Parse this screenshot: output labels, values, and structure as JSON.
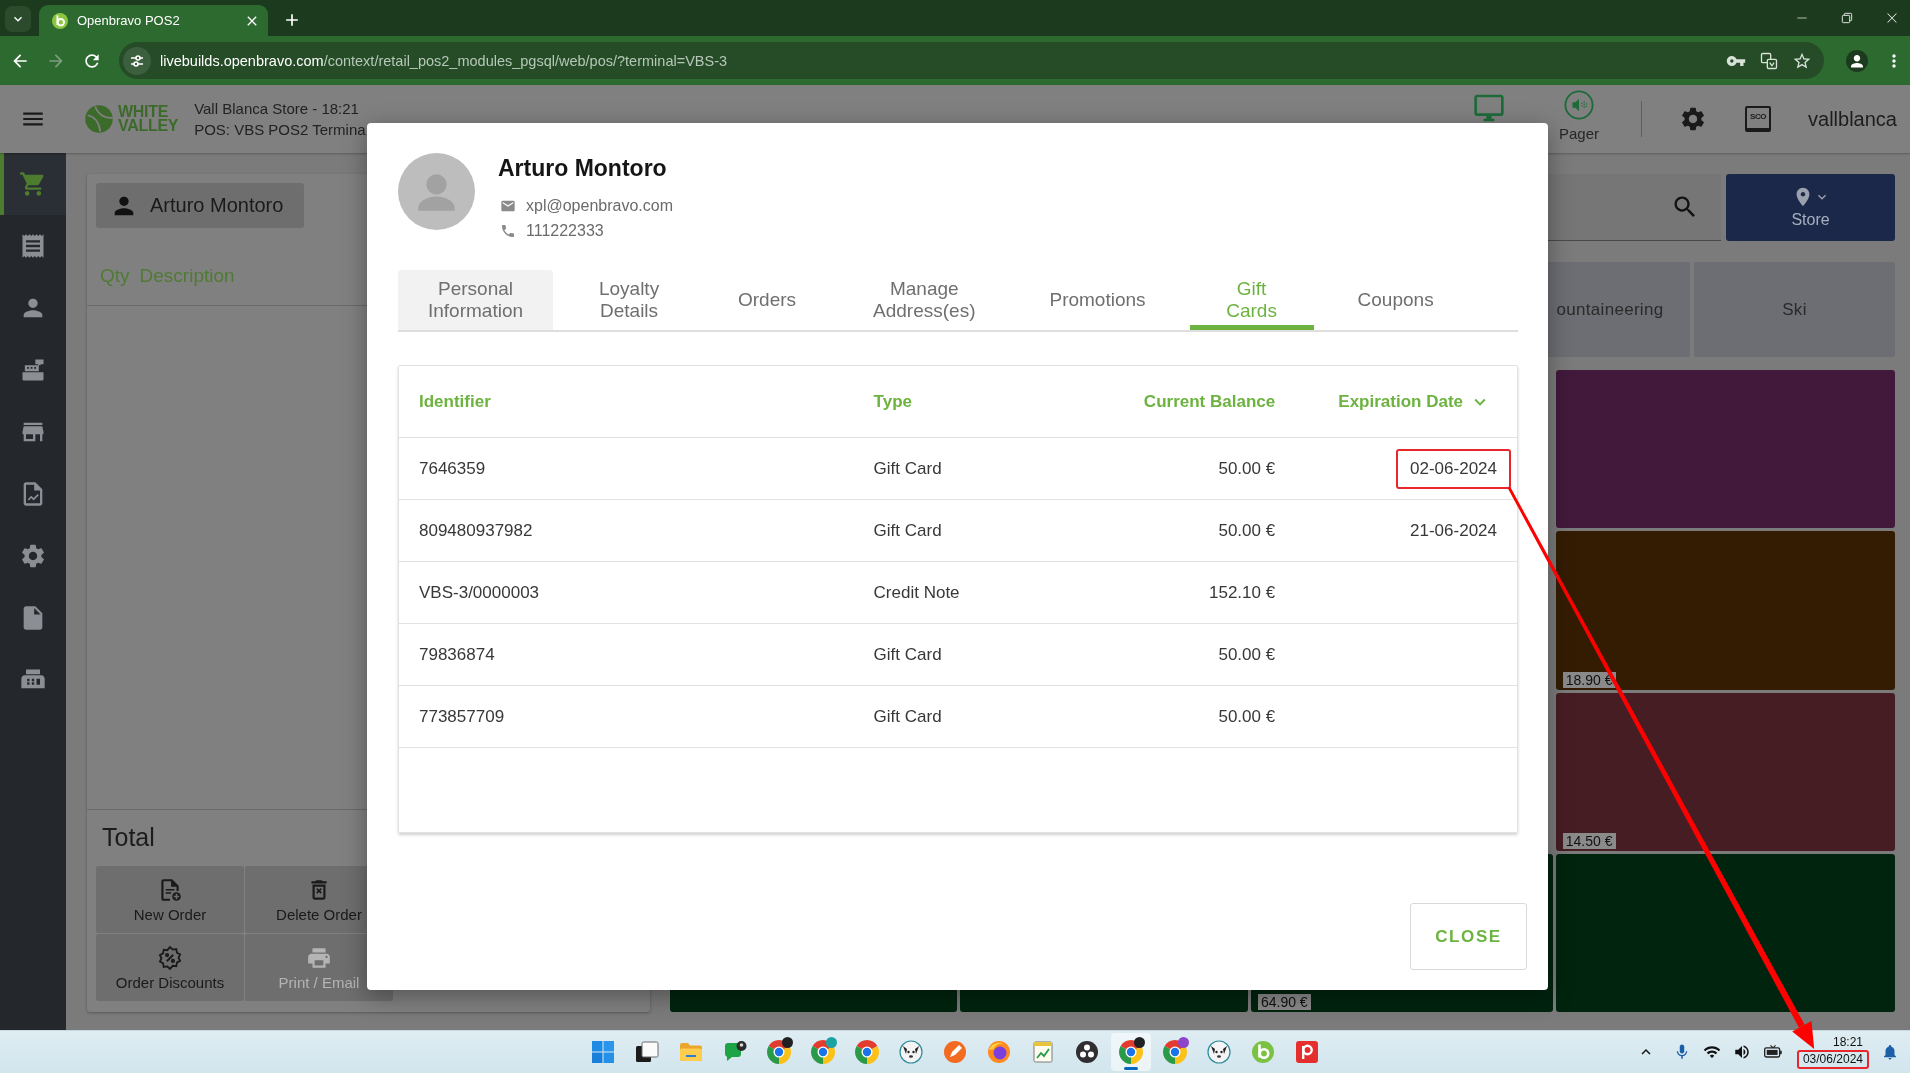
{
  "browser": {
    "tab": {
      "title": "Openbravo POS2"
    },
    "address": {
      "host": "livebuilds.openbravo.com",
      "path": "/context/retail_pos2_modules_pgsql/web/pos/?terminal=VBS-3"
    }
  },
  "header": {
    "logo": [
      "WHITE",
      "VALLEY"
    ],
    "store": "Vall Blanca Store - 18:21",
    "terminal": "POS: VBS POS2 Termina",
    "pager": "Pager",
    "sco": "SCO",
    "user": "vallblanca"
  },
  "sidebar": {
    "items": [
      {
        "kind": "cart",
        "selected": true
      },
      {
        "kind": "receipt",
        "selected": false
      },
      {
        "kind": "person",
        "selected": false
      },
      {
        "kind": "register",
        "selected": false
      },
      {
        "kind": "store",
        "selected": false
      },
      {
        "kind": "report",
        "selected": false
      },
      {
        "kind": "settings",
        "selected": false
      },
      {
        "kind": "document",
        "selected": false
      },
      {
        "kind": "printer",
        "selected": false
      }
    ]
  },
  "order": {
    "customer": "Arturo Montoro",
    "columns": [
      "Qty",
      "Description"
    ],
    "total": "Total",
    "buttons": [
      {
        "kind": "new",
        "label": "New Order",
        "disabled": false
      },
      {
        "kind": "delete",
        "label": "Delete Order",
        "disabled": false
      },
      {
        "kind": "discount",
        "label": "Order Discounts",
        "disabled": false
      },
      {
        "kind": "print",
        "label": "Print / Email",
        "disabled": true
      }
    ]
  },
  "catalog": {
    "store_button": "Store",
    "categories": [
      {
        "label": "ountaineering"
      },
      {
        "label": "Ski"
      }
    ],
    "product_rows": [
      {
        "tiles": [
          {
            "color": "#42193b"
          }
        ]
      },
      {
        "tiles": [
          {
            "color": "#341c03",
            "price": "18.90 €"
          }
        ]
      },
      {
        "tiles": [
          {
            "color": "#461d23",
            "price": "14.50 €"
          }
        ]
      },
      {
        "tiles": [
          {
            "color": "#00240e"
          },
          {
            "color": "#00240e"
          },
          {
            "color": "#00240e",
            "price": "64.90 €"
          },
          {
            "color": "#00240e"
          }
        ]
      }
    ]
  },
  "dialog": {
    "customer": {
      "name": "Arturo Montoro",
      "email": "xpl@openbravo.com",
      "phone": "111222333"
    },
    "tabs": [
      {
        "label": "Personal Information",
        "selected": false,
        "hovered": true
      },
      {
        "label": "Loyalty Details",
        "selected": false,
        "hovered": false
      },
      {
        "label": "Orders",
        "selected": false,
        "hovered": false
      },
      {
        "label": "Manage Address(es)",
        "selected": false,
        "hovered": false
      },
      {
        "label": "Promotions",
        "selected": false,
        "hovered": false
      },
      {
        "label": "Gift Cards",
        "selected": true,
        "hovered": false
      },
      {
        "label": "Coupons",
        "selected": false,
        "hovered": false
      }
    ],
    "table": {
      "columns": [
        {
          "label": "Identifier",
          "sorted": false
        },
        {
          "label": "Type",
          "sorted": false
        },
        {
          "label": "Current Balance",
          "sorted": false
        },
        {
          "label": "Expiration Date",
          "sorted": true
        }
      ],
      "rows": [
        {
          "identifier": "7646359",
          "type": "Gift Card",
          "balance": "50.00 €",
          "expiration": "02-06-2024",
          "highlighted": true
        },
        {
          "identifier": "809480937982",
          "type": "Gift Card",
          "balance": "50.00 €",
          "expiration": "21-06-2024",
          "highlighted": false
        },
        {
          "identifier": "VBS-3/0000003",
          "type": "Credit Note",
          "balance": "152.10 €",
          "highlighted": false
        },
        {
          "identifier": "79836874",
          "type": "Gift Card",
          "balance": "50.00 €",
          "highlighted": false
        },
        {
          "identifier": "773857709",
          "type": "Gift Card",
          "balance": "50.00 €",
          "highlighted": false
        }
      ]
    },
    "close_button": "CLOSE"
  },
  "taskbar": {
    "apps": [
      {
        "kind": "start",
        "selected": false
      },
      {
        "kind": "stack",
        "selected": false
      },
      {
        "kind": "folder",
        "selected": false
      },
      {
        "kind": "chat",
        "selected": false
      },
      {
        "kind": "chrome",
        "color": "#202124",
        "selected": false
      },
      {
        "kind": "chrome",
        "color": "#1aa3a3",
        "selected": false
      },
      {
        "kind": "chrome",
        "selected": false
      },
      {
        "kind": "animal",
        "selected": false
      },
      {
        "kind": "pen",
        "selected": false
      },
      {
        "kind": "firefox",
        "selected": false
      },
      {
        "kind": "chart",
        "selected": false
      },
      {
        "kind": "obs",
        "selected": false
      },
      {
        "kind": "chrome",
        "color": "#202124",
        "selected": true
      },
      {
        "kind": "chrome",
        "color": "#8e44c9",
        "selected": false
      },
      {
        "kind": "animal",
        "selected": false
      },
      {
        "kind": "logo-b",
        "selected": false
      },
      {
        "kind": "red-app",
        "selected": false
      }
    ],
    "clock": {
      "time": "18:21",
      "date": "03/06/2024",
      "highlighted": true
    }
  },
  "annotations": [
    {
      "kind": "arrow"
    }
  ]
}
